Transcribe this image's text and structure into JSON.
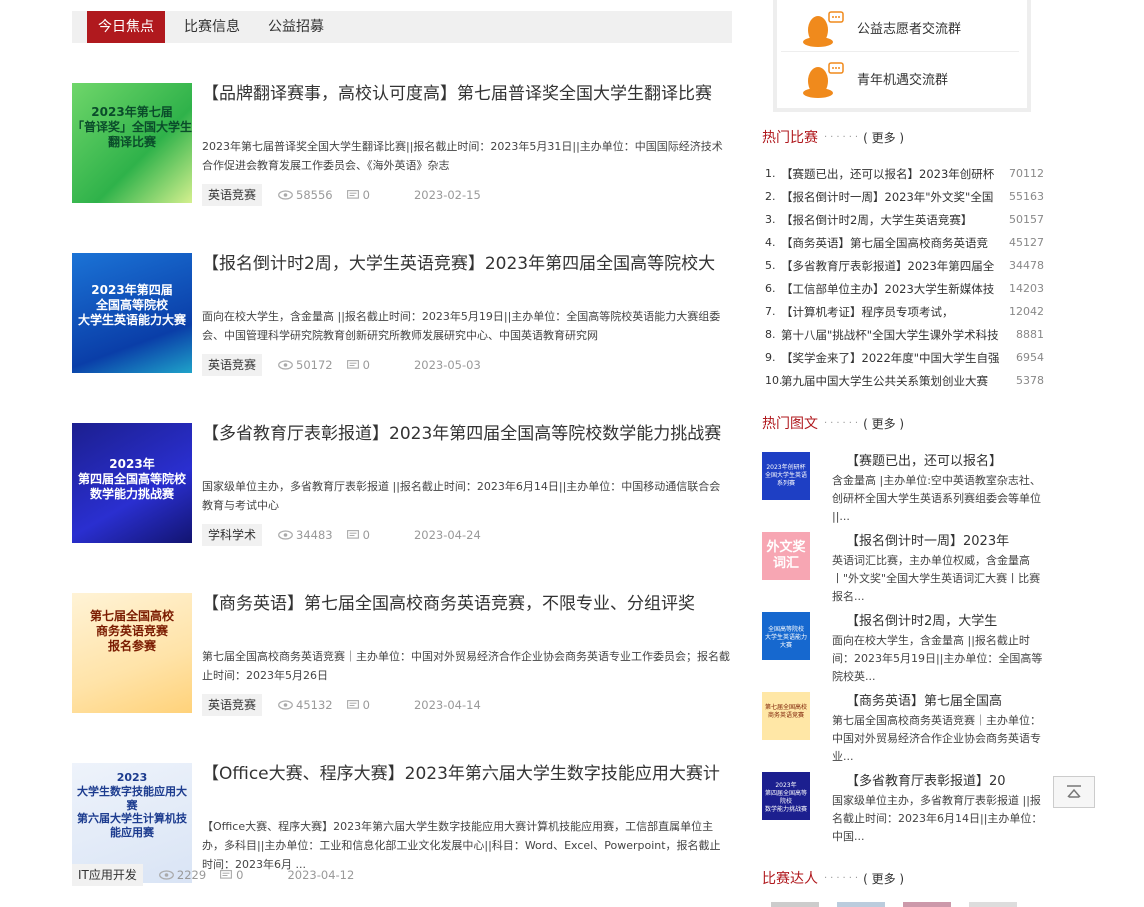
{
  "tabs": [
    {
      "label": "今日焦点",
      "active": true
    },
    {
      "label": "比赛信息",
      "active": false
    },
    {
      "label": "公益招募",
      "active": false
    }
  ],
  "articles": [
    {
      "title": "【品牌翻译赛事，高校认可度高】第七届普译奖全国大学生翻译比赛",
      "desc": "2023年第七届普译奖全国大学生翻译比赛||报名截止时间：2023年5月31日||主办单位：中国国际经济技术合作促进会教育发展工作委员会、《海外英语》杂志",
      "tag": "英语竞赛",
      "views": "58556",
      "comments": "0",
      "date": "2023-02-15",
      "thumb_text": "2023年第七届\n「普译奖」全国大学生翻译比赛"
    },
    {
      "title": "【报名倒计时2周，大学生英语竞赛】2023年第四届全国高等院校大",
      "desc": "面向在校大学生，含金量高 ||报名截止时间：2023年5月19日||主办单位：全国高等院校英语能力大赛组委会、中国管理科学研究院教育创新研究所教师发展研究中心、中国英语教育研究网",
      "tag": "英语竞赛",
      "views": "50172",
      "comments": "0",
      "date": "2023-05-03",
      "thumb_text": "2023年第四届\n全国高等院校\n大学生英语能力大赛"
    },
    {
      "title": "【多省教育厅表彰报道】2023年第四届全国高等院校数学能力挑战赛",
      "desc": "国家级单位主办，多省教育厅表彰报道 ||报名截止时间：2023年6月14日||主办单位：中国移动通信联合会教育与考试中心",
      "tag": "学科学术",
      "views": "34483",
      "comments": "0",
      "date": "2023-04-24",
      "thumb_text": "2023年\n第四届全国高等院校\n数学能力挑战赛"
    },
    {
      "title": "【商务英语】第七届全国高校商务英语竞赛，不限专业、分组评奖",
      "desc": "第七届全国高校商务英语竞赛｜主办单位：中国对外贸易经济合作企业协会商务英语专业工作委员会；报名截止时间：2023年5月26日",
      "tag": "英语竞赛",
      "views": "45132",
      "comments": "0",
      "date": "2023-04-14",
      "thumb_text": "第七届全国高校\n商务英语竞赛\n报名参赛"
    },
    {
      "title": "【Office大赛、程序大赛】2023年第六届大学生数字技能应用大赛计",
      "desc": "【Office大赛、程序大赛】2023年第六届大学生数字技能应用大赛计算机技能应用赛，工信部直属单位主办，多科目||主办单位：工业和信息化部工业文化发展中心||科目：Word、Excel、Powerpoint，报名截止时间：2023年6月 ...",
      "tag": "IT应用开发",
      "views": "2229",
      "comments": "0",
      "date": "2023-04-12",
      "thumb_text": "2023\n大学生数字技能应用大赛\n第六届大学生计算机技能应用赛"
    }
  ],
  "groups": [
    {
      "label": "公益志愿者交流群",
      "icon": "qq-penguin-icon"
    },
    {
      "label": "青年机遇交流群",
      "icon": "qq-penguin-icon"
    }
  ],
  "hot_contests": {
    "title": "热门比赛",
    "more": "( 更多 )",
    "items": [
      {
        "num": "1.",
        "title": "【赛题已出，还可以报名】2023年创研杯",
        "count": "70112"
      },
      {
        "num": "2.",
        "title": "【报名倒计时一周】2023年\"外文奖\"全国",
        "count": "55163"
      },
      {
        "num": "3.",
        "title": "【报名倒计时2周，大学生英语竞赛】",
        "count": "50157"
      },
      {
        "num": "4.",
        "title": "【商务英语】第七届全国高校商务英语竞",
        "count": "45127"
      },
      {
        "num": "5.",
        "title": "【多省教育厅表彰报道】2023年第四届全",
        "count": "34478"
      },
      {
        "num": "6.",
        "title": "【工信部单位主办】2023大学生新媒体技",
        "count": "14203"
      },
      {
        "num": "7.",
        "title": "【计算机考证】程序员专项考试，",
        "count": "12042"
      },
      {
        "num": "8.",
        "title": "第十八届\"挑战杯\"全国大学生课外学术科技",
        "count": "8881"
      },
      {
        "num": "9.",
        "title": "【奖学金来了】2022年度\"中国大学生自强",
        "count": "6954"
      },
      {
        "num": "10.",
        "title": "第九届中国大学生公共关系策划创业大赛",
        "count": "5378"
      }
    ]
  },
  "hot_pics": {
    "title": "热门图文",
    "more": "( 更多 )",
    "items": [
      {
        "title": "【赛题已出，还可以报名】",
        "desc": "含金量高 |主办单位:空中英语教室杂志社、创研杯全国大学生英语系列赛组委会等单位 ||..."
      },
      {
        "title": "【报名倒计时一周】2023年",
        "desc": "英语词汇比赛，主办单位权威，含金量高丨\"外文奖\"全国大学生英语词汇大赛丨比赛报名..."
      },
      {
        "title": "【报名倒计时2周，大学生",
        "desc": "面向在校大学生，含金量高 ||报名截止时间：2023年5月19日||主办单位：全国高等院校英..."
      },
      {
        "title": "【商务英语】第七届全国高",
        "desc": "第七届全国高校商务英语竞赛｜主办单位：中国对外贸易经济合作企业协会商务英语专业..."
      },
      {
        "title": "【多省教育厅表彰报道】20",
        "desc": "国家级单位主办，多省教育厅表彰报道 ||报名截止时间：2023年6月14日||主办单位：中国..."
      }
    ],
    "thumb_texts": [
      "2023年创研杯全国大学生英语系列赛",
      "外文奖\n词汇",
      "全国高等院校\n大学生英语能力大赛",
      "第七届全国高校\n商务英语竞赛",
      "2023年\n第四届全国高等院校\n数学能力挑战赛"
    ]
  },
  "talents": {
    "title": "比赛达人",
    "more": "( 更多 )"
  },
  "colors": {
    "accent": "#b0191e",
    "qq_orange": "#f08a1c"
  }
}
